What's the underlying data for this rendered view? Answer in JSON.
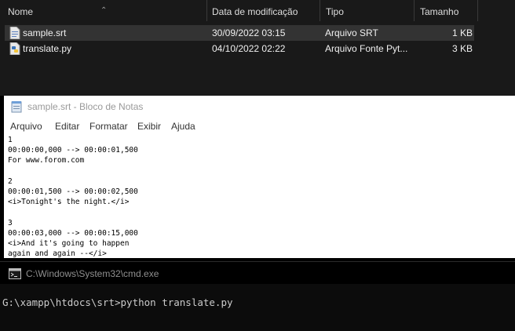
{
  "explorer": {
    "columns": [
      "Nome",
      "Data de modificação",
      "Tipo",
      "Tamanho"
    ],
    "files": [
      {
        "name": "sample.srt",
        "modified": "30/09/2022 03:15",
        "type": "Arquivo SRT",
        "size": "1 KB",
        "icon": "srt-file-icon",
        "selected": true
      },
      {
        "name": "translate.py",
        "modified": "04/10/2022 02:22",
        "type": "Arquivo Fonte Pyt...",
        "size": "3 KB",
        "icon": "python-file-icon",
        "selected": false
      }
    ]
  },
  "notepad": {
    "title": "sample.srt - Bloco de Notas",
    "menu": [
      "Arquivo",
      "Editar",
      "Formatar",
      "Exibir",
      "Ajuda"
    ],
    "content": "1\n00:00:00,000 --> 00:00:01,500\nFor www.forom.com\n\n2\n00:00:01,500 --> 00:00:02,500\n<i>Tonight's the night.</i>\n\n3\n00:00:03,000 --> 00:00:15,000\n<i>And it's going to happen\nagain and again --</i>"
  },
  "cmd": {
    "title": "C:\\Windows\\System32\\cmd.exe",
    "prompt_line": "G:\\xampp\\htdocs\\srt>python translate.py"
  },
  "colors": {
    "explorer_bg": "#191919",
    "selection_bg": "#333333",
    "notepad_bg": "#ffffff",
    "cmd_bg": "#0c0c0c",
    "cmd_text": "#cccccc"
  }
}
